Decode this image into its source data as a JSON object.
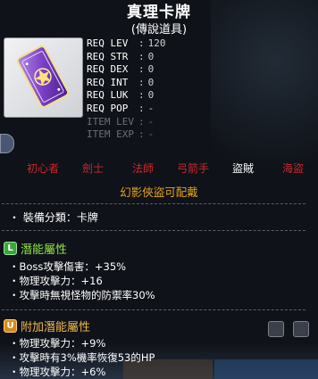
{
  "item": {
    "name": "真理卡牌",
    "rarity": "(傳說道具)",
    "icon": "purple-star-card-icon",
    "requirements": [
      {
        "label": "REQ LEV",
        "value": "120",
        "dim": false
      },
      {
        "label": "REQ STR",
        "value": "0",
        "dim": false
      },
      {
        "label": "REQ DEX",
        "value": "0",
        "dim": false
      },
      {
        "label": "REQ INT",
        "value": "0",
        "dim": false
      },
      {
        "label": "REQ LUK",
        "value": "0",
        "dim": false
      },
      {
        "label": "REQ POP",
        "value": "-",
        "dim": false
      },
      {
        "label": "ITEM LEV",
        "value": "-",
        "dim": true
      },
      {
        "label": "ITEM EXP",
        "value": "-",
        "dim": true
      }
    ],
    "jobs": [
      {
        "label": "初心者",
        "active": false
      },
      {
        "label": "劍士",
        "active": false
      },
      {
        "label": "法師",
        "active": false
      },
      {
        "label": "弓箭手",
        "active": false
      },
      {
        "label": "盜賊",
        "active": true
      },
      {
        "label": "海盜",
        "active": false
      }
    ],
    "job_note": "幻影俠盜可配戴",
    "category": "・ 裝備分類：卡牌",
    "potential": {
      "title": "潛能屬性",
      "badge": "L",
      "lines": [
        "・Boss攻擊傷害：+35%",
        "・物理攻擊力：+16",
        "・攻擊時無視怪物的防禦率30%"
      ]
    },
    "additional": {
      "title": "附加潛能屬性",
      "badge": "U",
      "lines": [
        "・物理攻擊力：+9%",
        "・攻擊時有3%機率恢復53的HP",
        "・物理攻擊力：+6%"
      ]
    }
  },
  "colors": {
    "job_inactive": "#c8282c",
    "job_active": "#ffffff",
    "job_note": "#e8a21e",
    "potential_head": "#8ee64a",
    "additional_head": "#f2b84a"
  }
}
